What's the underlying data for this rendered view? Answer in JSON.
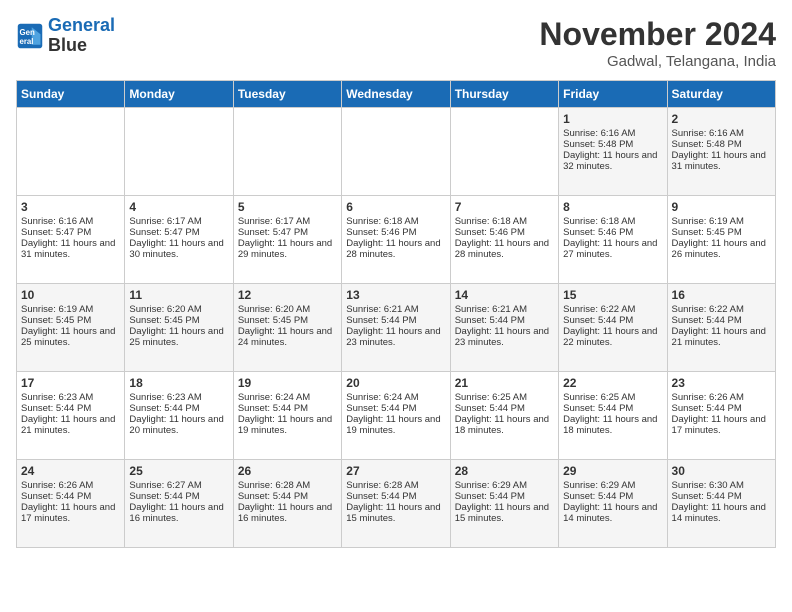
{
  "header": {
    "logo_line1": "General",
    "logo_line2": "Blue",
    "month_title": "November 2024",
    "subtitle": "Gadwal, Telangana, India"
  },
  "days_of_week": [
    "Sunday",
    "Monday",
    "Tuesday",
    "Wednesday",
    "Thursday",
    "Friday",
    "Saturday"
  ],
  "weeks": [
    [
      {
        "day": "",
        "content": ""
      },
      {
        "day": "",
        "content": ""
      },
      {
        "day": "",
        "content": ""
      },
      {
        "day": "",
        "content": ""
      },
      {
        "day": "",
        "content": ""
      },
      {
        "day": "1",
        "content": "Sunrise: 6:16 AM\nSunset: 5:48 PM\nDaylight: 11 hours and 32 minutes."
      },
      {
        "day": "2",
        "content": "Sunrise: 6:16 AM\nSunset: 5:48 PM\nDaylight: 11 hours and 31 minutes."
      }
    ],
    [
      {
        "day": "3",
        "content": "Sunrise: 6:16 AM\nSunset: 5:47 PM\nDaylight: 11 hours and 31 minutes."
      },
      {
        "day": "4",
        "content": "Sunrise: 6:17 AM\nSunset: 5:47 PM\nDaylight: 11 hours and 30 minutes."
      },
      {
        "day": "5",
        "content": "Sunrise: 6:17 AM\nSunset: 5:47 PM\nDaylight: 11 hours and 29 minutes."
      },
      {
        "day": "6",
        "content": "Sunrise: 6:18 AM\nSunset: 5:46 PM\nDaylight: 11 hours and 28 minutes."
      },
      {
        "day": "7",
        "content": "Sunrise: 6:18 AM\nSunset: 5:46 PM\nDaylight: 11 hours and 28 minutes."
      },
      {
        "day": "8",
        "content": "Sunrise: 6:18 AM\nSunset: 5:46 PM\nDaylight: 11 hours and 27 minutes."
      },
      {
        "day": "9",
        "content": "Sunrise: 6:19 AM\nSunset: 5:45 PM\nDaylight: 11 hours and 26 minutes."
      }
    ],
    [
      {
        "day": "10",
        "content": "Sunrise: 6:19 AM\nSunset: 5:45 PM\nDaylight: 11 hours and 25 minutes."
      },
      {
        "day": "11",
        "content": "Sunrise: 6:20 AM\nSunset: 5:45 PM\nDaylight: 11 hours and 25 minutes."
      },
      {
        "day": "12",
        "content": "Sunrise: 6:20 AM\nSunset: 5:45 PM\nDaylight: 11 hours and 24 minutes."
      },
      {
        "day": "13",
        "content": "Sunrise: 6:21 AM\nSunset: 5:44 PM\nDaylight: 11 hours and 23 minutes."
      },
      {
        "day": "14",
        "content": "Sunrise: 6:21 AM\nSunset: 5:44 PM\nDaylight: 11 hours and 23 minutes."
      },
      {
        "day": "15",
        "content": "Sunrise: 6:22 AM\nSunset: 5:44 PM\nDaylight: 11 hours and 22 minutes."
      },
      {
        "day": "16",
        "content": "Sunrise: 6:22 AM\nSunset: 5:44 PM\nDaylight: 11 hours and 21 minutes."
      }
    ],
    [
      {
        "day": "17",
        "content": "Sunrise: 6:23 AM\nSunset: 5:44 PM\nDaylight: 11 hours and 21 minutes."
      },
      {
        "day": "18",
        "content": "Sunrise: 6:23 AM\nSunset: 5:44 PM\nDaylight: 11 hours and 20 minutes."
      },
      {
        "day": "19",
        "content": "Sunrise: 6:24 AM\nSunset: 5:44 PM\nDaylight: 11 hours and 19 minutes."
      },
      {
        "day": "20",
        "content": "Sunrise: 6:24 AM\nSunset: 5:44 PM\nDaylight: 11 hours and 19 minutes."
      },
      {
        "day": "21",
        "content": "Sunrise: 6:25 AM\nSunset: 5:44 PM\nDaylight: 11 hours and 18 minutes."
      },
      {
        "day": "22",
        "content": "Sunrise: 6:25 AM\nSunset: 5:44 PM\nDaylight: 11 hours and 18 minutes."
      },
      {
        "day": "23",
        "content": "Sunrise: 6:26 AM\nSunset: 5:44 PM\nDaylight: 11 hours and 17 minutes."
      }
    ],
    [
      {
        "day": "24",
        "content": "Sunrise: 6:26 AM\nSunset: 5:44 PM\nDaylight: 11 hours and 17 minutes."
      },
      {
        "day": "25",
        "content": "Sunrise: 6:27 AM\nSunset: 5:44 PM\nDaylight: 11 hours and 16 minutes."
      },
      {
        "day": "26",
        "content": "Sunrise: 6:28 AM\nSunset: 5:44 PM\nDaylight: 11 hours and 16 minutes."
      },
      {
        "day": "27",
        "content": "Sunrise: 6:28 AM\nSunset: 5:44 PM\nDaylight: 11 hours and 15 minutes."
      },
      {
        "day": "28",
        "content": "Sunrise: 6:29 AM\nSunset: 5:44 PM\nDaylight: 11 hours and 15 minutes."
      },
      {
        "day": "29",
        "content": "Sunrise: 6:29 AM\nSunset: 5:44 PM\nDaylight: 11 hours and 14 minutes."
      },
      {
        "day": "30",
        "content": "Sunrise: 6:30 AM\nSunset: 5:44 PM\nDaylight: 11 hours and 14 minutes."
      }
    ]
  ]
}
